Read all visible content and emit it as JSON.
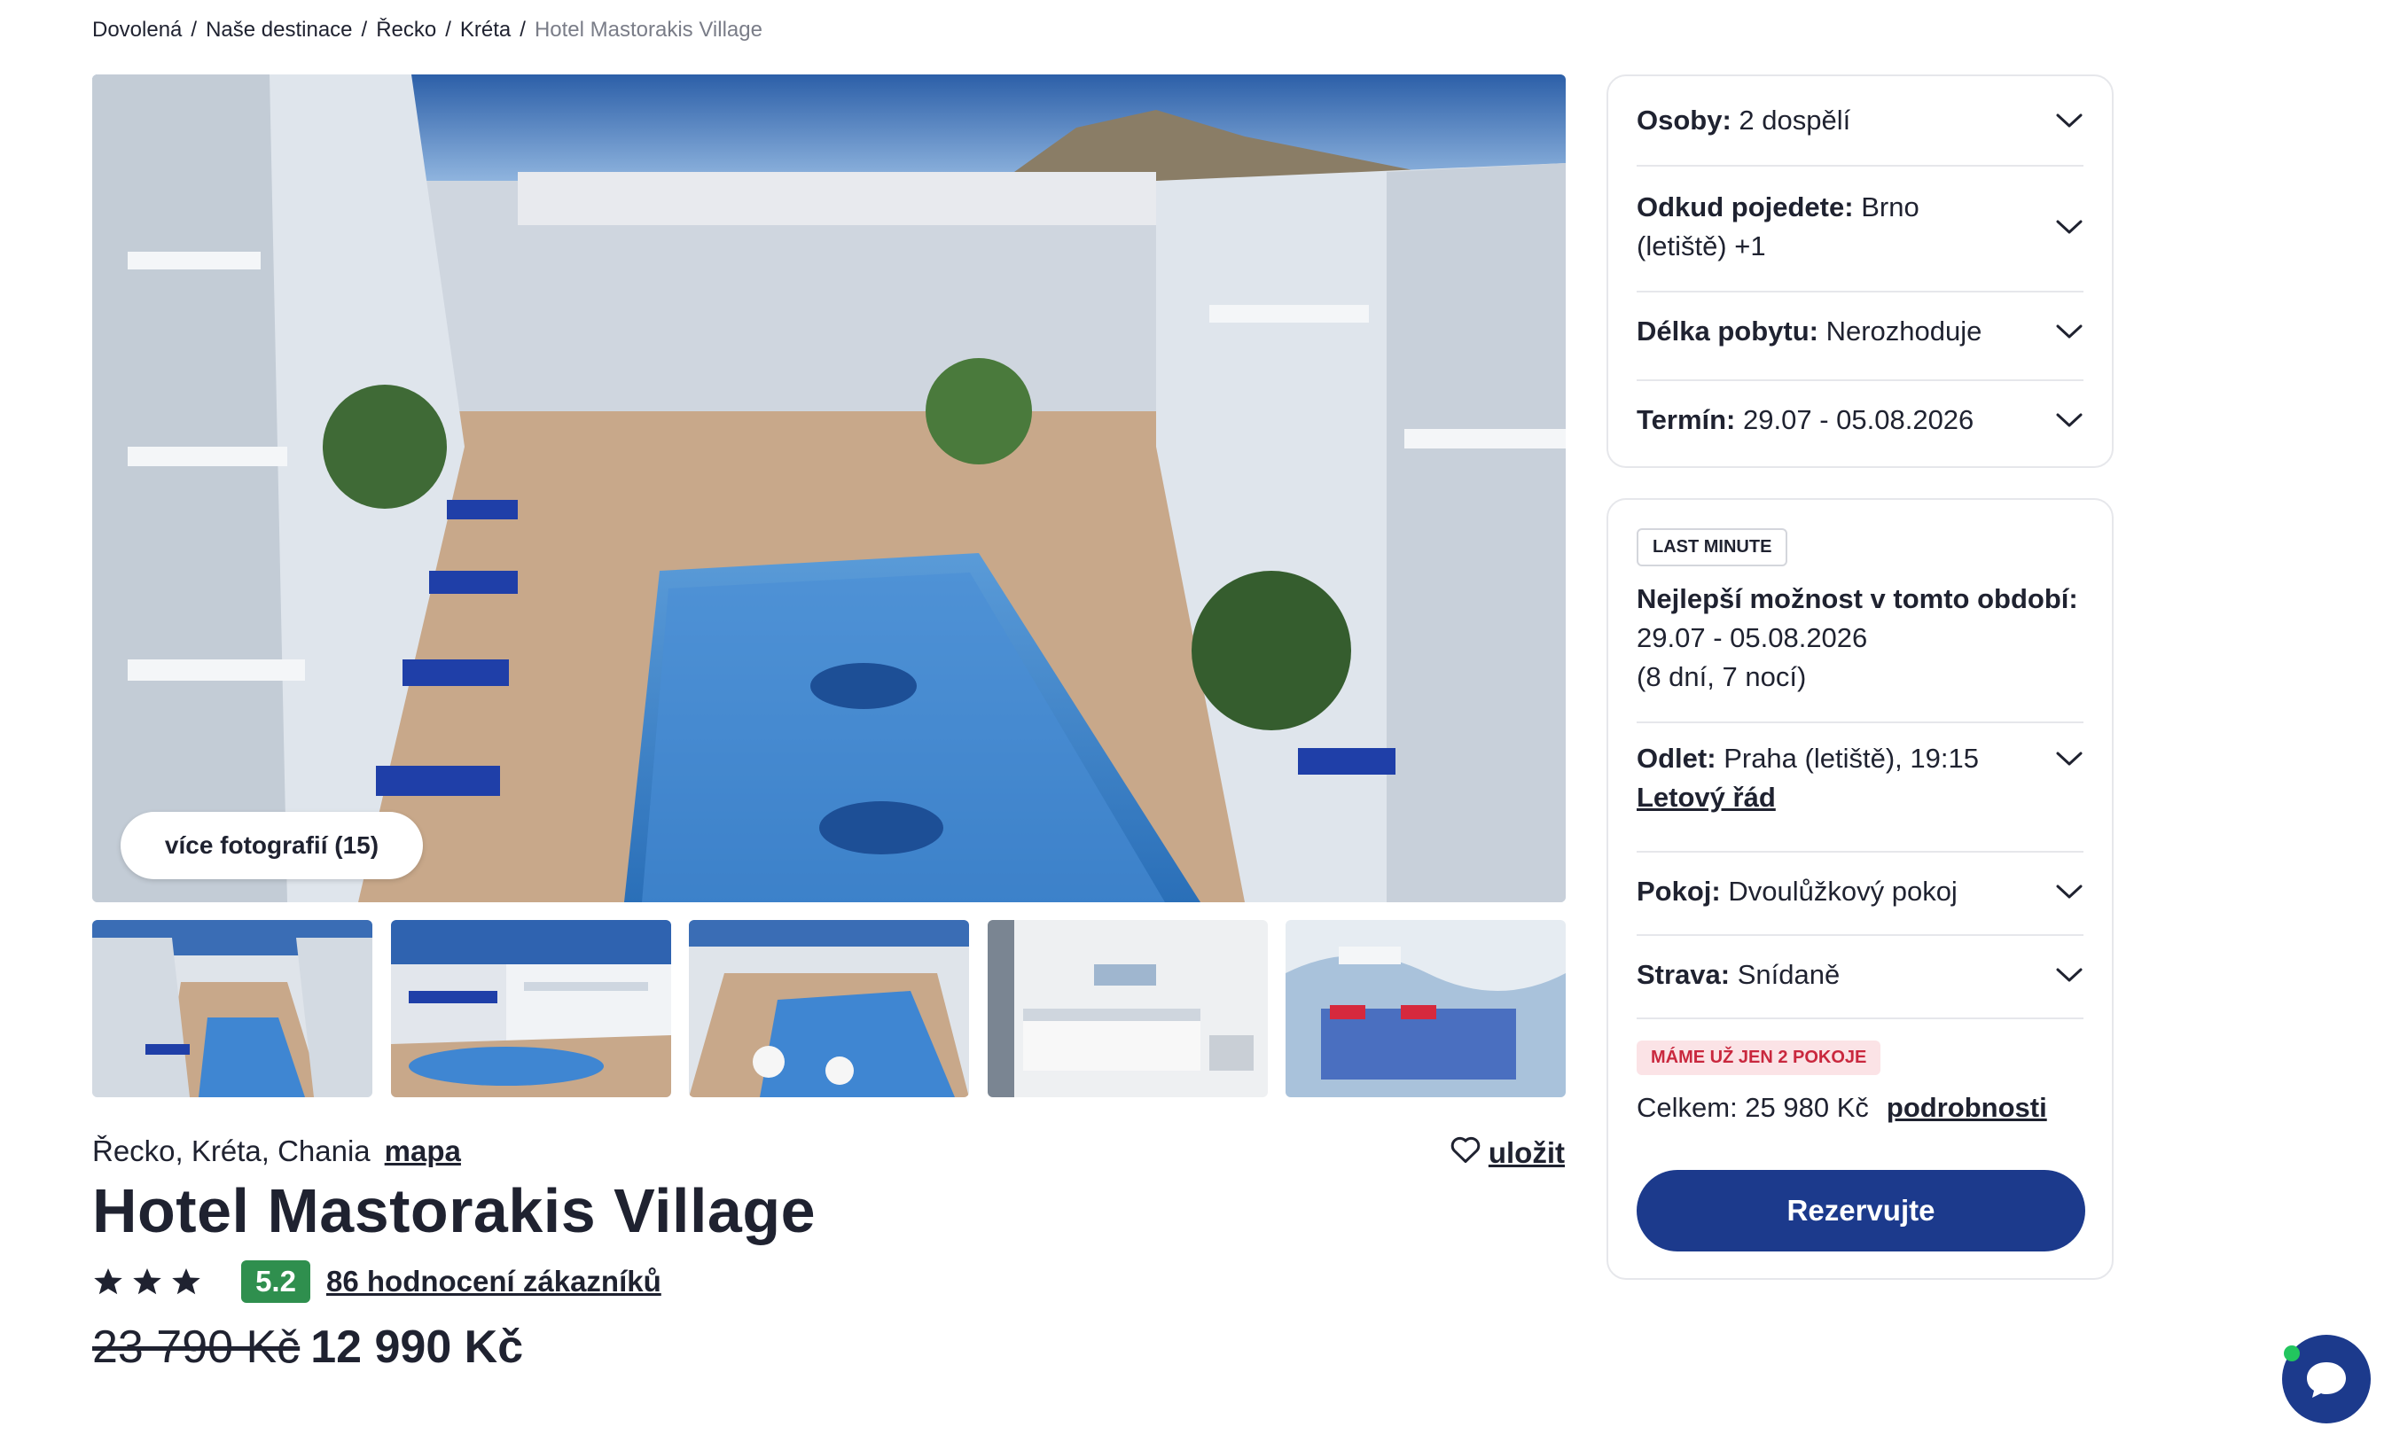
{
  "breadcrumb": {
    "items": [
      "Dovolená",
      "Naše destinace",
      "Řecko",
      "Kréta"
    ],
    "current": "Hotel Mastorakis Village",
    "separator": "/"
  },
  "gallery": {
    "more_photos_label": "více fotografií (15)",
    "thumbnails": [
      "pool-view-1",
      "pool-view-2",
      "pool-view-3",
      "bedroom-twin",
      "bedroom-double"
    ]
  },
  "hotel": {
    "location": "Řecko, Kréta, Chania",
    "map_label": "mapa",
    "save_label": "uložit",
    "name": "Hotel Mastorakis Village",
    "stars": 3,
    "score": "5.2",
    "reviews_label": "86 hodnocení zákazníků",
    "old_price": "23 790 Kč",
    "price": "12 990 Kč"
  },
  "filters": {
    "persons": {
      "label": "Osoby:",
      "value": "2 dospělí"
    },
    "departure": {
      "label": "Odkud pojedete:",
      "value": "Brno",
      "value2": "(letiště) +1"
    },
    "length": {
      "label": "Délka pobytu:",
      "value": "Nerozhoduje"
    },
    "term": {
      "label": "Termín:",
      "value": "29.07 - 05.08.2026"
    }
  },
  "offer": {
    "badge": "LAST MINUTE",
    "best_title": "Nejlepší možnost v tomto období:",
    "dates": "29.07 - 05.08.2026",
    "nights": "(8 dní, 7 nocí)",
    "flight": {
      "label": "Odlet:",
      "value": "Praha (letiště), 19:15",
      "link": "Letový řád"
    },
    "room": {
      "label": "Pokoj:",
      "value": "Dvoulůžkový pokoj"
    },
    "board": {
      "label": "Strava:",
      "value": "Snídaně"
    },
    "rooms_badge": "MÁME UŽ JEN 2 POKOJE",
    "total_label": "Celkem: 25 980 Kč",
    "details_label": "podrobnosti",
    "reserve_label": "Rezervujte"
  },
  "colors": {
    "primary": "#1c3a8c",
    "score_green": "#2f8f4e",
    "alert_red": "#c9283e",
    "chat_online": "#22c55e"
  }
}
